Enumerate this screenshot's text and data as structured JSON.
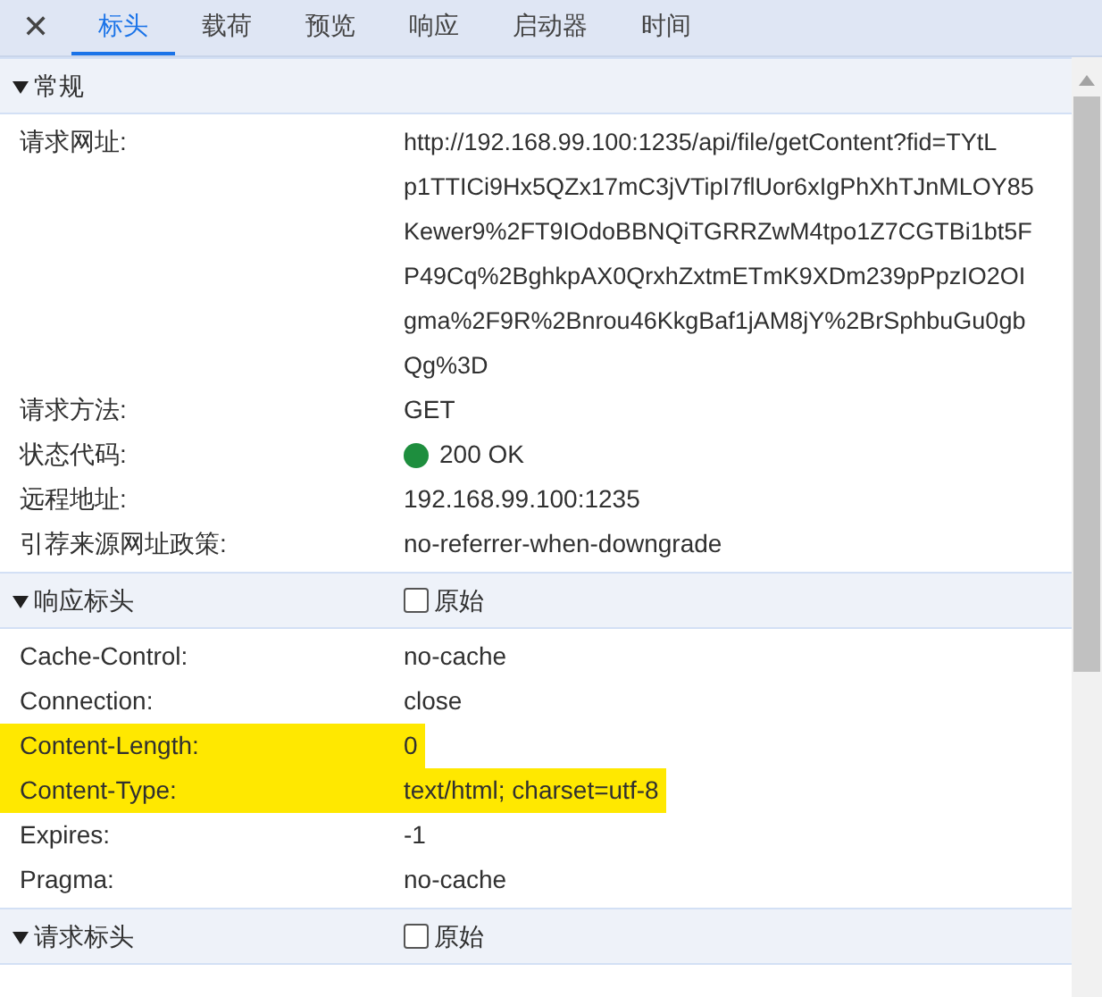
{
  "close_label": "✕",
  "tabs": [
    {
      "label": "标头",
      "selected": true
    },
    {
      "label": "载荷",
      "selected": false
    },
    {
      "label": "预览",
      "selected": false
    },
    {
      "label": "响应",
      "selected": false
    },
    {
      "label": "启动器",
      "selected": false
    },
    {
      "label": "时间",
      "selected": false
    }
  ],
  "sections": [
    {
      "title": "常规",
      "expanded": true,
      "rows": [
        {
          "kind": "url",
          "name": "请求网址:",
          "value_lines": [
            "http://192.168.99.100:1235/api/file/getContent?fid=TYtL",
            "p1TTICi9Hx5QZx17mC3jVTipI7flUor6xIgPhXhTJnMLOY85",
            "Kewer9%2FT9IOdoBBNQiTGRRZwM4tpo1Z7CGTBi1bt5F",
            "P49Cq%2BghkpAX0QrxhZxtmETmK9XDm239pPpzIO2OI",
            "gma%2F9R%2Bnrou46KkgBaf1jAM8jY%2BrSphbuGu0gb",
            "Qg%3D"
          ],
          "highlighted": false
        },
        {
          "kind": "text",
          "name": "请求方法:",
          "value": "GET",
          "highlighted": false
        },
        {
          "kind": "status",
          "name": "状态代码:",
          "value": "200 OK",
          "highlighted": false
        },
        {
          "kind": "text",
          "name": "远程地址:",
          "value": "192.168.99.100:1235",
          "highlighted": false
        },
        {
          "kind": "text",
          "name": "引荐来源网址政策:",
          "value": "no-referrer-when-downgrade",
          "highlighted": false
        }
      ]
    },
    {
      "title": "响应标头",
      "expanded": true,
      "raw": {
        "label": "原始",
        "checked": false
      },
      "rows": [
        {
          "kind": "text",
          "name": "Cache-Control:",
          "value": "no-cache",
          "highlighted": false
        },
        {
          "kind": "text",
          "name": "Connection:",
          "value": "close",
          "highlighted": false
        },
        {
          "kind": "text",
          "name": "Content-Length:",
          "value": "0",
          "highlighted": true
        },
        {
          "kind": "text",
          "name": "Content-Type:",
          "value": "text/html; charset=utf-8",
          "highlighted": true
        },
        {
          "kind": "text",
          "name": "Expires:",
          "value": "-1",
          "highlighted": false
        },
        {
          "kind": "text",
          "name": "Pragma:",
          "value": "no-cache",
          "highlighted": false
        }
      ]
    },
    {
      "title": "请求标头",
      "expanded": true,
      "raw": {
        "label": "原始",
        "checked": false
      }
    }
  ]
}
